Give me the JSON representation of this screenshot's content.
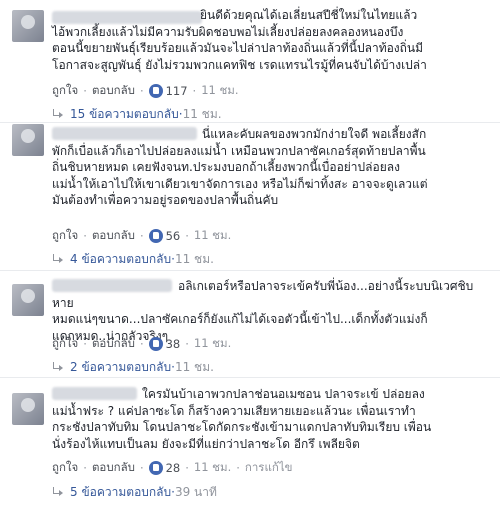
{
  "comments": [
    {
      "text": "ยินดีด้วยคุณได้เอเลี่ยนสปีชี่ใหม่ในไทยแล้ว\nไอ้พวกเลี้ยงแล้วไม่มีความรับผิดชอบพอไม่เลี้ยงปล่อยลงคลองหนองบึง\nตอนนี้ขยายพันธุ์เรียบร้อยแล้วมันจะไปล่าปลาท้องถิ่นแล้วที่นี้ปลาท้องถิ่นมี\nโอกาสจะสูญพันธุ์ ยังไม่รวมพวกแคทฟิช เรดแทรนไรมู้ที่คนจับได้บ้างเปล่า",
      "like_label": "ถูกใจ",
      "reply_label": "ตอบกลับ",
      "likes": "117",
      "time": "11 ชม.",
      "replies_label": "15 ข้อความตอบกลับ",
      "replies_time": "11 ชม."
    },
    {
      "text": "นี่แหละคับผลของพวกมักง่ายใจดี พอเลี้ยงสัก\nพักก็เบื่อแล้วก็เอาไปปล่อยลงแม่น้ำ เหมือนพวกปลาซัคเกอร์สุดท้ายปลาพื้น\nถิ่นชิบหายหมด เคยฟังจนท.ประมงบอกถ้าเลี้ยงพวกนี้เบื่ออย่าปล่อยลง\nแม่น้ำให้เอาไปให้เขาเดียวเขาจัดการเอง หรือไม่ก็ฆ่าทิ้งสะ อาจจะดูเลวแต่\nมันต้องทำเพื่อความอยู่รอดของปลาพื้นถิ่นคับ",
      "like_label": "ถูกใจ",
      "reply_label": "ตอบกลับ",
      "likes": "56",
      "time": "11 ชม.",
      "replies_label": "4 ข้อความตอบกลับ",
      "replies_time": "11 ชม."
    },
    {
      "text": "อลิเกเตอร์หรือปลาจระเข้ครับพี่น้อง...อย่างนี้ระบบนิเวศชิบหาย\nหมดแน่ๆขนาด...ปลาซัคเกอร์ก็ยังแก้ไม่ได้เจอตัวนี้เข้าไป...เด็กทั้งตัวแม่งก็\nแดกหมด..น่ากลัวจริงๆ",
      "like_label": "ถูกใจ",
      "reply_label": "ตอบกลับ",
      "likes": "38",
      "time": "11 ชม.",
      "replies_label": "2 ข้อความตอบกลับ",
      "replies_time": "11 ชม."
    },
    {
      "text": "ใครมันบ้าเอาพวกปลาช่อนอเมซอน ปลาจระเข้ ปล่อยลง\nแม่น้ำฟระ ? แค่ปลาซะโด ก็สร้างความเสียหายเยอะแล้วนะ เพื่อนเราทำ\nกระชังปลาทับทิม โดนปลาชะโดกัดกระชังเข้ามาแดกปลาทับทิมเรียบ เพื่อน\nนั่งร้องไห้แทบเป็นลม ยังจะมีที่แย่กว่าปลาชะโด อีกรึ เพลียจิต",
      "like_label": "ถูกใจ",
      "reply_label": "ตอบกลับ",
      "likes": "28",
      "time": "11 ชม.",
      "edited_label": "การแก้ไข",
      "replies_label": "5 ข้อความตอบกลับ",
      "replies_time": "39 นาที"
    }
  ],
  "colors": {
    "link": "#365899",
    "meta": "#90949c",
    "like_badge": "#4267b2",
    "divider": "#e9ebee"
  }
}
